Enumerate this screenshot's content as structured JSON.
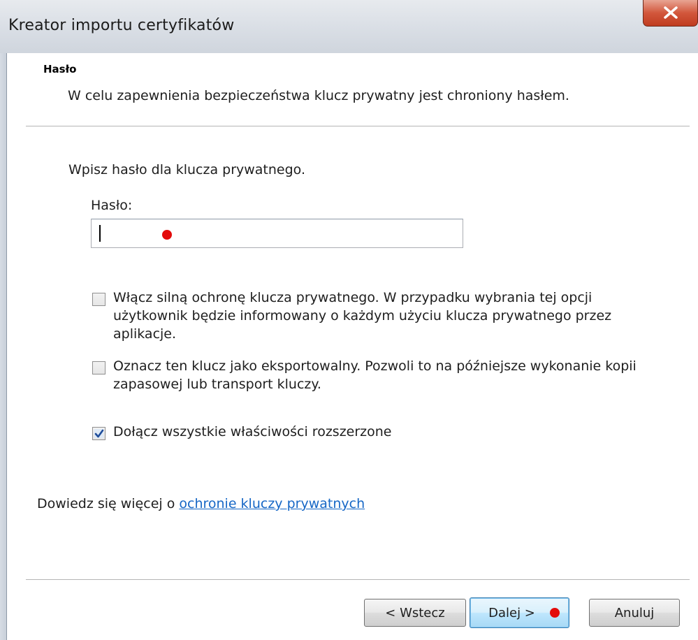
{
  "window": {
    "title": "Kreator importu certyfikatów",
    "close_glyph": "x",
    "close_icon": "close-icon"
  },
  "page": {
    "heading": "Hasło",
    "description": "W celu zapewnienia bezpieczeństwa klucz prywatny jest chroniony hasłem."
  },
  "form": {
    "prompt": "Wpisz hasło dla klucza prywatnego.",
    "password_label": "Hasło:",
    "password_value": ""
  },
  "options": [
    {
      "lines": [
        "Włącz silną ochronę klucza prywatnego. W przypadku wybrania tej opcji",
        "użytkownik będzie informowany o każdym użyciu klucza prywatnego przez",
        "aplikacje."
      ],
      "checked": false
    },
    {
      "lines": [
        "Oznacz ten klucz jako eksportowalny. Pozwoli to na późniejsze wykonanie kopii",
        "zapasowej lub transport kluczy."
      ],
      "checked": false
    },
    {
      "lines": [
        "Dołącz wszystkie właściwości rozszerzone"
      ],
      "checked": true
    }
  ],
  "learn_more": {
    "prefix": "Dowiedz się więcej o ",
    "link": "ochronie kluczy prywatnych"
  },
  "buttons": {
    "back": "< Wstecz",
    "next": "Dalej >",
    "cancel": "Anuluj"
  },
  "markers": {
    "color": "#e30b0b"
  }
}
